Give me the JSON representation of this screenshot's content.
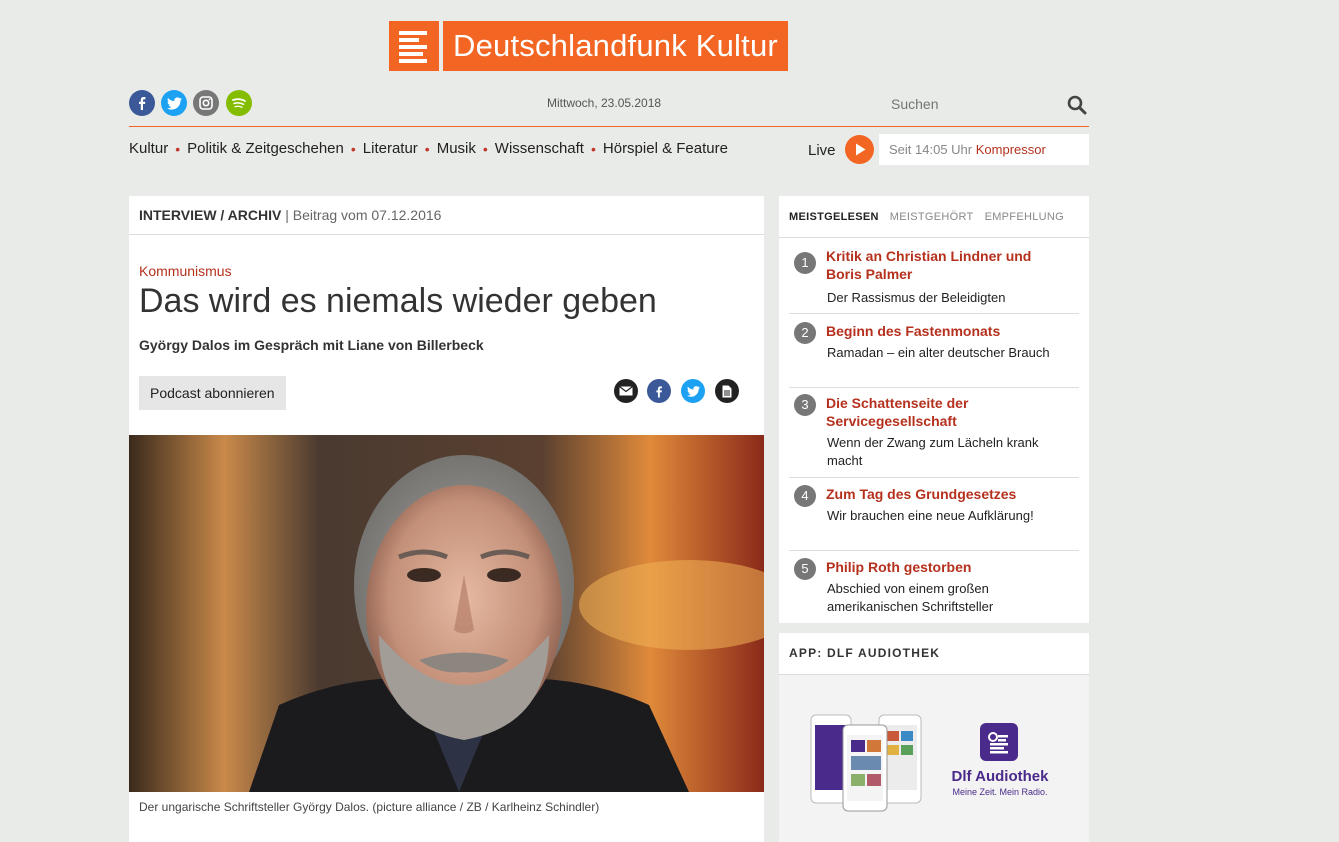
{
  "brand": {
    "name": "Deutschlandfunk Kultur",
    "color": "#f26522"
  },
  "header": {
    "social": [
      {
        "name": "facebook-icon",
        "color": "#3b5998"
      },
      {
        "name": "twitter-icon",
        "color": "#1da1f2"
      },
      {
        "name": "instagram-icon",
        "color": "#777777"
      },
      {
        "name": "spotify-icon",
        "color": "#84bd00"
      }
    ],
    "date": "Mittwoch, 23.05.2018",
    "search_placeholder": "Suchen"
  },
  "nav": {
    "items": [
      "Kultur",
      "Politik & Zeitgeschehen",
      "Literatur",
      "Musik",
      "Wissenschaft",
      "Hörspiel & Feature"
    ],
    "live_label": "Live",
    "now_time": "Seit 14:05 Uhr",
    "now_show": "Kompressor"
  },
  "article": {
    "category": "INTERVIEW / ARCHIV",
    "separator": "|",
    "date": "Beitrag vom 07.12.2016",
    "kicker": "Kommunismus",
    "title": "Das wird es niemals wieder geben",
    "subtitle": "György Dalos im Gespräch mit Liane von Billerbeck",
    "podcast_button": "Podcast abonnieren",
    "share_icons": [
      "mail-icon",
      "facebook-icon",
      "twitter-icon",
      "print-icon"
    ],
    "caption": "Der ungarische Schriftsteller György Dalos. (picture alliance / ZB / Karlheinz Schindler)"
  },
  "most": {
    "tabs": [
      "MEISTGELESEN",
      "MEISTGEHÖRT",
      "EMPFEHLUNG"
    ],
    "items": [
      {
        "num": "1",
        "headline": "Kritik an Christian Lindner und Boris Palmer",
        "teaser": "Der Rassismus der Beleidigten"
      },
      {
        "num": "2",
        "headline": "Beginn des Fastenmonats",
        "teaser": "Ramadan – ein alter deutscher Brauch"
      },
      {
        "num": "3",
        "headline": "Die Schattenseite der Servicegesellschaft",
        "teaser": "Wenn der Zwang zum Lächeln krank macht"
      },
      {
        "num": "4",
        "headline": "Zum Tag des Grundgesetzes",
        "teaser": "Wir brauchen eine neue Aufklärung!"
      },
      {
        "num": "5",
        "headline": "Philip Roth gestorben",
        "teaser": "Abschied von einem großen amerikanischen Schriftsteller"
      }
    ]
  },
  "app": {
    "heading": "APP: DLF AUDIOTHEK",
    "app_name": "Dlf Audiothek",
    "slogan": "Meine Zeit. Mein Radio.",
    "accent": "#4a2a8a"
  }
}
